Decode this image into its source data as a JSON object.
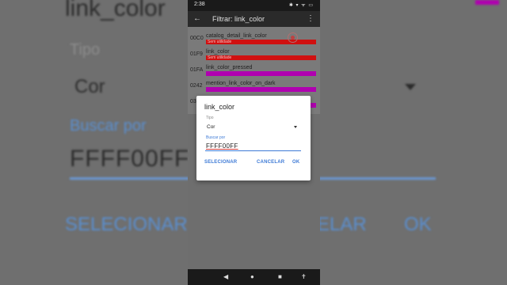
{
  "background": {
    "title": "link_color",
    "tipo_label": "Tipo",
    "tipo_value": "Cor",
    "buscar_label": "Buscar por",
    "buscar_value": "FFFF00FF",
    "btn_select": "SELECIONAR",
    "btn_cancel_partial": "ELAR",
    "btn_ok": "OK"
  },
  "status_bar": {
    "time": "2:38",
    "icons": "✱ ▾ ᯤ ▭"
  },
  "app_bar": {
    "title": "Filtrar: link_color"
  },
  "list": [
    {
      "code": "00C0",
      "name": "catalog_detail_link_color",
      "bar_color": "#d01010",
      "bar_text": "Sem utilidade"
    },
    {
      "code": "01F9",
      "name": "link_color",
      "bar_color": "#d01010",
      "bar_text": "Sem utilidade"
    },
    {
      "code": "01FA",
      "name": "link_color_pressed",
      "bar_color": "#b000b0",
      "bar_text": ""
    },
    {
      "code": "0242",
      "name": "mention_link_color_on_dark",
      "bar_color": "#b000b0",
      "bar_text": ""
    },
    {
      "code": "03",
      "name": "",
      "bar_color": "#b000b0",
      "bar_text": ""
    }
  ],
  "dialog": {
    "title": "link_color",
    "tipo_label": "Tipo",
    "tipo_value": "Cor",
    "buscar_label": "Buscar por",
    "buscar_value": "FFFF00FF",
    "btn_select": "SELECIONAR",
    "btn_cancel": "CANCELAR",
    "btn_ok": "OK"
  },
  "nav": {
    "back": "◀",
    "home": "●",
    "recents": "■",
    "accessibility": "✝"
  },
  "colors": {
    "accent": "#3d7ad6",
    "red_bar": "#d01010",
    "magenta_bar": "#b000b0"
  }
}
